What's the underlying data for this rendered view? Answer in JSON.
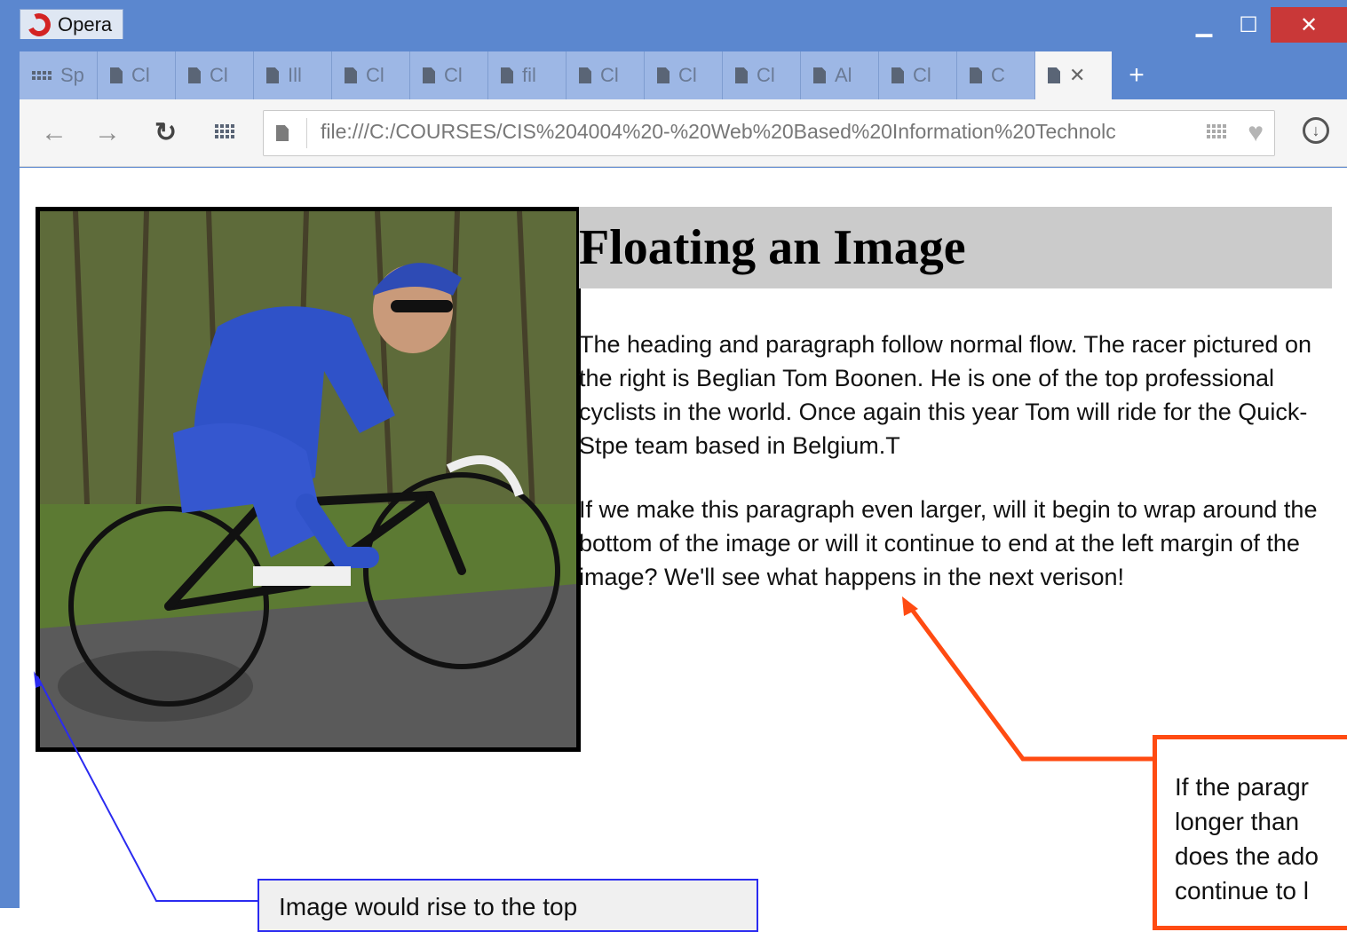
{
  "browser": {
    "app_name": "Opera",
    "tabs": [
      "Sp",
      "Cl",
      "Cl",
      "Ill",
      "Cl",
      "Cl",
      "fil",
      "Cl",
      "Cl",
      "Cl",
      "Al",
      "Cl",
      "C"
    ],
    "active_tab_close": "✕",
    "new_tab": "+",
    "url": "file:///C:/COURSES/CIS%204004%20-%20Web%20Based%20Information%20Technolc"
  },
  "page": {
    "heading": "Floating an Image",
    "paragraph1": "The heading and paragraph follow normal flow. The racer pictured on the right is Beglian Tom Boonen. He is one of the top professional cyclists in the world. Once again this year Tom will ride for the Quick-Stpe team based in Belgium.T",
    "paragraph2": "If we make this paragraph even larger, will it begin to wrap around the bottom of the image or will it continue to end at the left margin of the image? We'll see what happens in the next verison!"
  },
  "annotations": {
    "red_note_lines": [
      "If the paragr",
      "longer than",
      "does the ado",
      "continue to l"
    ],
    "blue_note": "Image would rise to the top",
    "red_color": "#ff4b12",
    "blue_color": "#2b2bf0"
  }
}
